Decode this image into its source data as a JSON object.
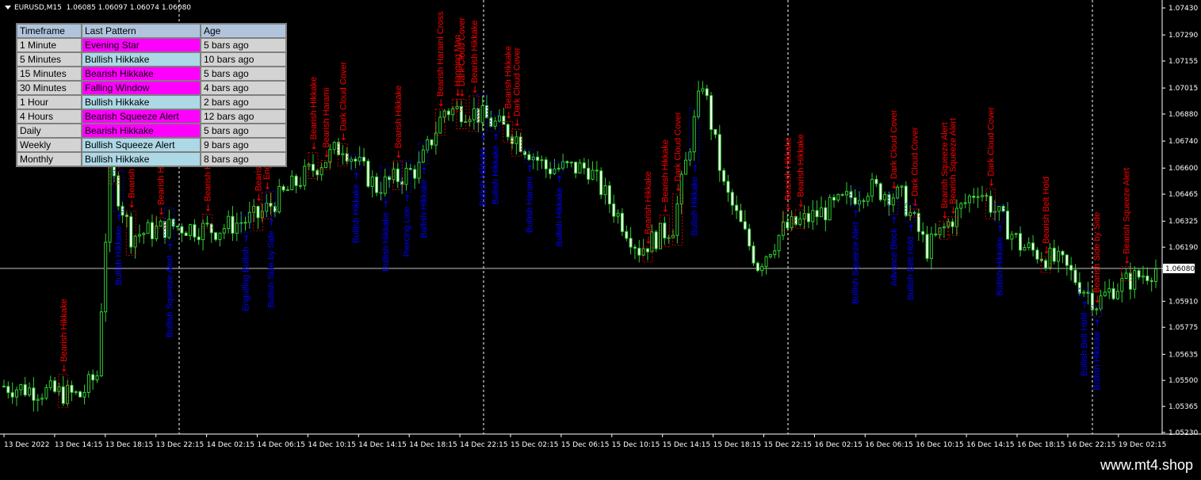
{
  "symbol": "EURUSD,M15",
  "ohlc": "1.06085 1.06097 1.06074 1.06080",
  "table": {
    "headers": [
      "Timeframe",
      "Last Pattern",
      "Age"
    ],
    "rows": [
      {
        "timeframe": "1 Minute",
        "pattern": "Evening Star",
        "age": "5 bars ago",
        "color": "#ff00ff"
      },
      {
        "timeframe": "5 Minutes",
        "pattern": "Bullish Hikkake",
        "age": "10 bars ago",
        "color": "#add8e6"
      },
      {
        "timeframe": "15 Minutes",
        "pattern": "Bearish Hikkake",
        "age": "5 bars ago",
        "color": "#ff00ff"
      },
      {
        "timeframe": "30 Minutes",
        "pattern": "Falling Window",
        "age": "4 bars ago",
        "color": "#ff00ff"
      },
      {
        "timeframe": "1 Hour",
        "pattern": "Bullish Hikkake",
        "age": "2 bars ago",
        "color": "#add8e6"
      },
      {
        "timeframe": "4 Hours",
        "pattern": "Bearish Squeeze Alert",
        "age": "12 bars ago",
        "color": "#ff00ff"
      },
      {
        "timeframe": "Daily",
        "pattern": "Bearish Hikkake",
        "age": "5 bars ago",
        "color": "#ff00ff"
      },
      {
        "timeframe": "Weekly",
        "pattern": "Bullish Squeeze Alert",
        "age": "9 bars ago",
        "color": "#add8e6"
      },
      {
        "timeframe": "Monthly",
        "pattern": "Bullish Hikkake",
        "age": "8 bars ago",
        "color": "#add8e6"
      }
    ]
  },
  "price_axis": [
    "1.07430",
    "1.07290",
    "1.07155",
    "1.07015",
    "1.06880",
    "1.06740",
    "1.06600",
    "1.06465",
    "1.06325",
    "1.06190",
    "1.06080",
    "1.05910",
    "1.05775",
    "1.05635",
    "1.05500",
    "1.05365",
    "1.05230"
  ],
  "current_price": "1.06080",
  "time_axis": [
    "13 Dec 2022",
    "13 Dec 14:15",
    "13 Dec 18:15",
    "13 Dec 22:15",
    "14 Dec 02:15",
    "14 Dec 06:15",
    "14 Dec 10:15",
    "14 Dec 14:15",
    "14 Dec 18:15",
    "14 Dec 22:15",
    "15 Dec 02:15",
    "15 Dec 06:15",
    "15 Dec 10:15",
    "15 Dec 14:15",
    "15 Dec 18:15",
    "15 Dec 22:15",
    "16 Dec 02:15",
    "16 Dec 06:15",
    "16 Dec 10:15",
    "16 Dec 14:15",
    "16 Dec 18:15",
    "16 Dec 22:15",
    "19 Dec 02:15"
  ],
  "bearish_labels": [
    {
      "text": "Bearish Hikkake",
      "bar": 14
    },
    {
      "text": "Bearish Squeeze Alert",
      "bar": 26
    },
    {
      "text": "Bearish Hikkake",
      "bar": 30
    },
    {
      "text": "Bearish Hikkake",
      "bar": 37
    },
    {
      "text": "Bearish Hikkake",
      "bar": 48
    },
    {
      "text": "Bearish Hikkake",
      "bar": 60
    },
    {
      "text": "Engulfing Bearish",
      "bar": 62
    },
    {
      "text": "Bearish Hikkake",
      "bar": 73
    },
    {
      "text": "Bearish Harami",
      "bar": 76
    },
    {
      "text": "Dark Cloud Cover",
      "bar": 80
    },
    {
      "text": "Bearish Hikkake",
      "bar": 93
    },
    {
      "text": "Bearish Harami Cross",
      "bar": 103
    },
    {
      "text": "Hanging Man",
      "bar": 107
    },
    {
      "text": "Dark Cloud Cover",
      "bar": 108
    },
    {
      "text": "Bearish Hikkake",
      "bar": 111
    },
    {
      "text": "Bearish Hikkake",
      "bar": 119
    },
    {
      "text": "Dark Cloud Cover",
      "bar": 121
    },
    {
      "text": "Bearish Hikkake",
      "bar": 152
    },
    {
      "text": "Bearish Hikkake",
      "bar": 156
    },
    {
      "text": "Dark Cloud Cover",
      "bar": 159
    },
    {
      "text": "Bearish Hikkake",
      "bar": 185
    },
    {
      "text": "Bearish Hikkake",
      "bar": 188
    },
    {
      "text": "Dark Cloud Cover",
      "bar": 210
    },
    {
      "text": "Dark Cloud Cover",
      "bar": 215
    },
    {
      "text": "Bearish Squeeze Alert",
      "bar": 222
    },
    {
      "text": "Bearish Squeeze Alert",
      "bar": 224
    },
    {
      "text": "Dark Cloud Cover",
      "bar": 233
    },
    {
      "text": "Bearish Belt Hold",
      "bar": 246
    },
    {
      "text": "Bearish Side by Side",
      "bar": 258
    },
    {
      "text": "Bearish Squeeze Alert",
      "bar": 265
    }
  ],
  "bullish_labels": [
    {
      "text": "Bullish Hikkake",
      "bar": 27
    },
    {
      "text": "Bullish Squeeze Alert",
      "bar": 39
    },
    {
      "text": "Engulfing Bullish",
      "bar": 57
    },
    {
      "text": "Bullish Side by Side",
      "bar": 63
    },
    {
      "text": "Bullish Hikkake",
      "bar": 83
    },
    {
      "text": "Bullish Hikkake",
      "bar": 90
    },
    {
      "text": "Piercing Line",
      "bar": 95
    },
    {
      "text": "Bullish Hikkake",
      "bar": 99
    },
    {
      "text": "Bullish Hikkake",
      "bar": 113
    },
    {
      "text": "Bullish Hikkake",
      "bar": 116
    },
    {
      "text": "Bullish Harami",
      "bar": 124
    },
    {
      "text": "Bullish Hikkake",
      "bar": 131
    },
    {
      "text": "Bullish Hikkake",
      "bar": 163
    },
    {
      "text": "Bullish Squeeze Alert",
      "bar": 201
    },
    {
      "text": "Advance Block",
      "bar": 210
    },
    {
      "text": "Bullish Belt Hold",
      "bar": 214
    },
    {
      "text": "Bullish Hikkake",
      "bar": 235
    },
    {
      "text": "Bullish Belt Hold",
      "bar": 255
    },
    {
      "text": "Bullish Hikkake",
      "bar": 258
    }
  ],
  "site": "www.mt4.shop"
}
